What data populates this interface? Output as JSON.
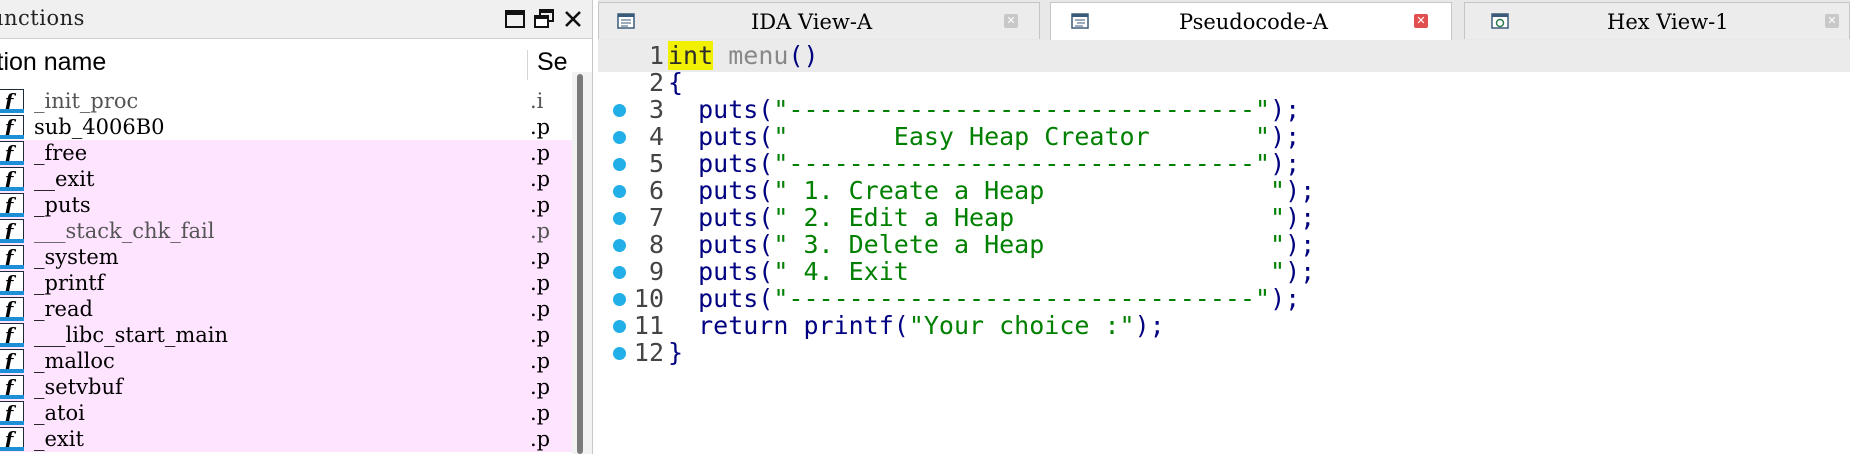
{
  "functions_pane": {
    "title": "unctions",
    "columns": {
      "name": "ction name",
      "segment": "Se"
    },
    "items": [
      {
        "name": "_init_proc",
        "segment": ".i",
        "highlighted": false,
        "dim": true
      },
      {
        "name": "sub_4006B0",
        "segment": ".p",
        "highlighted": false,
        "dim": false
      },
      {
        "name": "_free",
        "segment": ".p",
        "highlighted": true,
        "dim": false
      },
      {
        "name": "__exit",
        "segment": ".p",
        "highlighted": true,
        "dim": false
      },
      {
        "name": "_puts",
        "segment": ".p",
        "highlighted": true,
        "dim": false
      },
      {
        "name": "___stack_chk_fail",
        "segment": ".p",
        "highlighted": true,
        "dim": true
      },
      {
        "name": "_system",
        "segment": ".p",
        "highlighted": true,
        "dim": false
      },
      {
        "name": "_printf",
        "segment": ".p",
        "highlighted": true,
        "dim": false
      },
      {
        "name": "_read",
        "segment": ".p",
        "highlighted": true,
        "dim": false
      },
      {
        "name": "___libc_start_main",
        "segment": ".p",
        "highlighted": true,
        "dim": false
      },
      {
        "name": "_malloc",
        "segment": ".p",
        "highlighted": true,
        "dim": false
      },
      {
        "name": "_setvbuf",
        "segment": ".p",
        "highlighted": true,
        "dim": false
      },
      {
        "name": "_atoi",
        "segment": ".p",
        "highlighted": true,
        "dim": false
      },
      {
        "name": "_exit",
        "segment": ".p",
        "highlighted": true,
        "dim": false
      }
    ],
    "icon_glyph": "f"
  },
  "tabs": [
    {
      "label": "IDA View-A",
      "icon": "ida-view-icon",
      "active": false
    },
    {
      "label": "Pseudocode-A",
      "icon": "pseudocode-icon",
      "active": true
    },
    {
      "label": "Hex View-1",
      "icon": "hex-view-icon",
      "active": false
    }
  ],
  "pseudocode": {
    "lines": [
      {
        "num": "1",
        "breakpoint": false,
        "highlight": true,
        "tokens": [
          {
            "text": "int",
            "cls": "kw-int"
          },
          {
            "text": " ",
            "cls": "plain"
          },
          {
            "text": "menu",
            "cls": "fn-menu"
          },
          {
            "text": "()",
            "cls": "plain"
          }
        ]
      },
      {
        "num": "2",
        "breakpoint": false,
        "highlight": false,
        "tokens": [
          {
            "text": "{",
            "cls": "plain"
          }
        ]
      },
      {
        "num": "3",
        "breakpoint": true,
        "highlight": false,
        "tokens": [
          {
            "text": "  puts(",
            "cls": "plain"
          },
          {
            "text": "\"-------------------------------\"",
            "cls": "str"
          },
          {
            "text": ");",
            "cls": "plain"
          }
        ]
      },
      {
        "num": "4",
        "breakpoint": true,
        "highlight": false,
        "tokens": [
          {
            "text": "  puts(",
            "cls": "plain"
          },
          {
            "text": "\"       Easy Heap Creator       \"",
            "cls": "str"
          },
          {
            "text": ");",
            "cls": "plain"
          }
        ]
      },
      {
        "num": "5",
        "breakpoint": true,
        "highlight": false,
        "tokens": [
          {
            "text": "  puts(",
            "cls": "plain"
          },
          {
            "text": "\"-------------------------------\"",
            "cls": "str"
          },
          {
            "text": ");",
            "cls": "plain"
          }
        ]
      },
      {
        "num": "6",
        "breakpoint": true,
        "highlight": false,
        "tokens": [
          {
            "text": "  puts(",
            "cls": "plain"
          },
          {
            "text": "\" 1. Create a Heap               \"",
            "cls": "str"
          },
          {
            "text": ");",
            "cls": "plain"
          }
        ]
      },
      {
        "num": "7",
        "breakpoint": true,
        "highlight": false,
        "tokens": [
          {
            "text": "  puts(",
            "cls": "plain"
          },
          {
            "text": "\" 2. Edit a Heap                 \"",
            "cls": "str"
          },
          {
            "text": ");",
            "cls": "plain"
          }
        ]
      },
      {
        "num": "8",
        "breakpoint": true,
        "highlight": false,
        "tokens": [
          {
            "text": "  puts(",
            "cls": "plain"
          },
          {
            "text": "\" 3. Delete a Heap               \"",
            "cls": "str"
          },
          {
            "text": ");",
            "cls": "plain"
          }
        ]
      },
      {
        "num": "9",
        "breakpoint": true,
        "highlight": false,
        "tokens": [
          {
            "text": "  puts(",
            "cls": "plain"
          },
          {
            "text": "\" 4. Exit                        \"",
            "cls": "str"
          },
          {
            "text": ");",
            "cls": "plain"
          }
        ]
      },
      {
        "num": "10",
        "breakpoint": true,
        "highlight": false,
        "tokens": [
          {
            "text": "  puts(",
            "cls": "plain"
          },
          {
            "text": "\"-------------------------------\"",
            "cls": "str"
          },
          {
            "text": ");",
            "cls": "plain"
          }
        ]
      },
      {
        "num": "11",
        "breakpoint": true,
        "highlight": false,
        "tokens": [
          {
            "text": "  return printf(",
            "cls": "plain"
          },
          {
            "text": "\"Your choice :\"",
            "cls": "str"
          },
          {
            "text": ");",
            "cls": "plain"
          }
        ]
      },
      {
        "num": "12",
        "breakpoint": true,
        "highlight": false,
        "tokens": [
          {
            "text": "}",
            "cls": "plain"
          }
        ]
      }
    ]
  },
  "colors": {
    "pink_row": "#ffe4ff",
    "string": "#008000",
    "code": "#000080",
    "breakpoint_dot": "#22aee6",
    "keyword_highlight": "#f0f000"
  }
}
